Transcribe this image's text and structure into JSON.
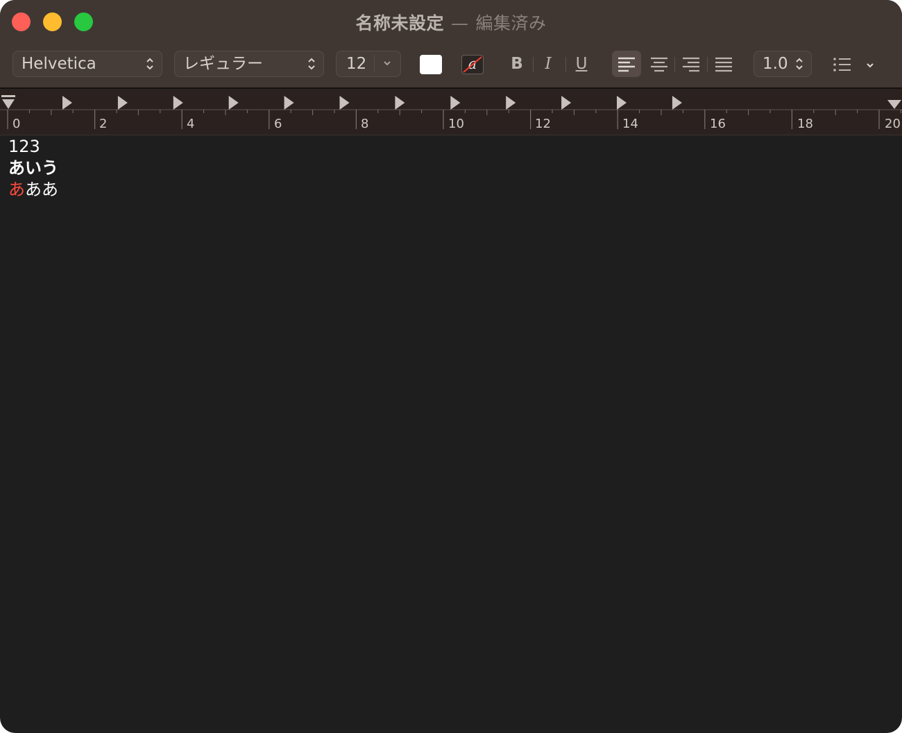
{
  "window": {
    "title": "名称未設定",
    "separator": "—",
    "status": "編集済み"
  },
  "toolbar": {
    "font_family": "Helvetica",
    "font_style": "レギュラー",
    "font_size": "12",
    "text_color": "#ffffff",
    "background_color_glyph": "a",
    "bold_label": "B",
    "italic_label": "I",
    "underline_label": "U",
    "alignment_selected": "left",
    "line_spacing": "1.0"
  },
  "ruler": {
    "labels": [
      "0",
      "2",
      "4",
      "6",
      "8",
      "10",
      "12",
      "14",
      "16",
      "18",
      "20"
    ]
  },
  "document": {
    "line1": "123",
    "line2": "あいう",
    "line3_first": "あ",
    "line3_rest": "ああ",
    "line3_first_color": "#ff4a3d"
  }
}
